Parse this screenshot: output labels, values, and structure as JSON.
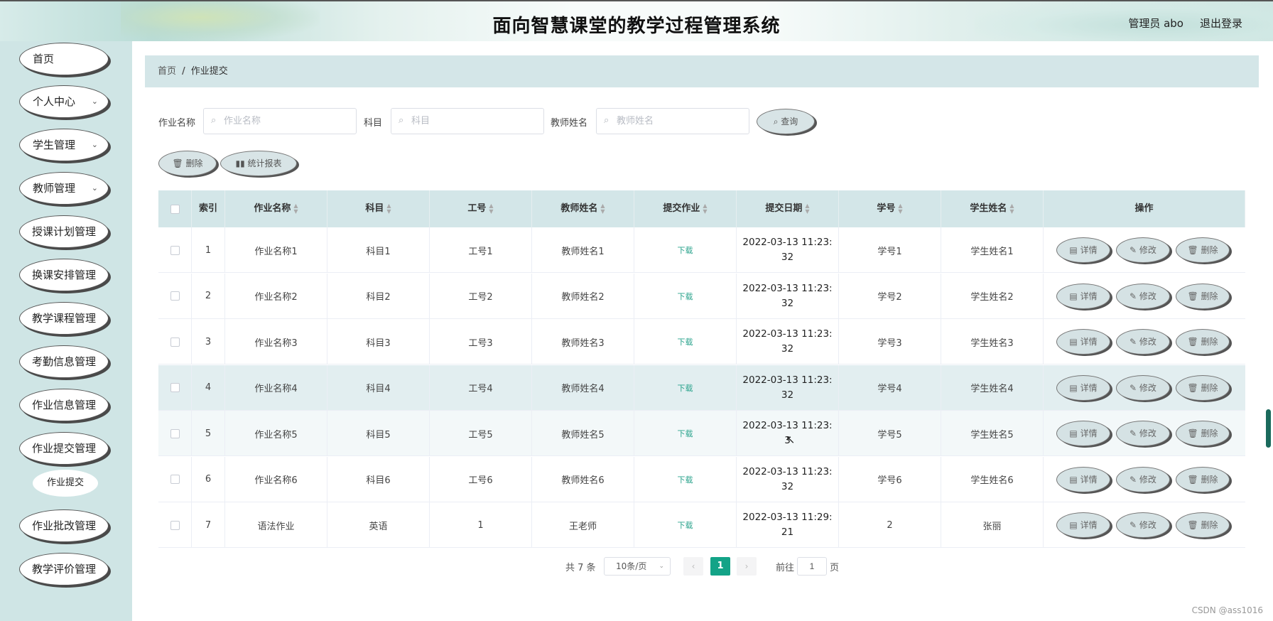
{
  "header": {
    "title": "面向智慧课堂的教学过程管理系统",
    "user": "管理员 abo",
    "logout": "退出登录"
  },
  "sidebar": {
    "items": [
      {
        "label": "首页",
        "chevron": ""
      },
      {
        "label": "个人中心",
        "chevron": "⌄"
      },
      {
        "label": "学生管理",
        "chevron": "⌄"
      },
      {
        "label": "教师管理",
        "chevron": "⌄"
      },
      {
        "label": "授课计划管理",
        "chevron": ""
      },
      {
        "label": "换课安排管理",
        "chevron": ""
      },
      {
        "label": "教学课程管理",
        "chevron": ""
      },
      {
        "label": "考勤信息管理",
        "chevron": ""
      },
      {
        "label": "作业信息管理",
        "chevron": ""
      },
      {
        "label": "作业提交管理",
        "chevron": ""
      },
      {
        "label": "作业批改管理",
        "chevron": ""
      },
      {
        "label": "教学评价管理",
        "chevron": ""
      }
    ],
    "submenu": {
      "label": "作业提交"
    }
  },
  "breadcrumb": {
    "home": "首页",
    "separator": "/",
    "current": "作业提交"
  },
  "search": {
    "homework_label": "作业名称",
    "homework_placeholder": "作业名称",
    "subject_label": "科目",
    "subject_placeholder": "科目",
    "teacher_label": "教师姓名",
    "teacher_placeholder": "教师姓名",
    "query_button": "查询",
    "search_icon": "search-icon"
  },
  "actions": {
    "delete_label": "删除",
    "report_label": "统计报表"
  },
  "table": {
    "columns": [
      "索引",
      "作业名称",
      "科目",
      "工号",
      "教师姓名",
      "提交作业",
      "提交日期",
      "学号",
      "学生姓名",
      "操作"
    ],
    "rows": [
      {
        "index": "1",
        "name": "作业名称1",
        "subject": "科目1",
        "job_no": "工号1",
        "teacher": "教师姓名1",
        "file": "下载",
        "date": "2022-03-13 11:23:32",
        "student_no": "学号1",
        "student": "学生姓名1"
      },
      {
        "index": "2",
        "name": "作业名称2",
        "subject": "科目2",
        "job_no": "工号2",
        "teacher": "教师姓名2",
        "file": "下载",
        "date": "2022-03-13 11:23:32",
        "student_no": "学号2",
        "student": "学生姓名2"
      },
      {
        "index": "3",
        "name": "作业名称3",
        "subject": "科目3",
        "job_no": "工号3",
        "teacher": "教师姓名3",
        "file": "下载",
        "date": "2022-03-13 11:23:32",
        "student_no": "学号3",
        "student": "学生姓名3"
      },
      {
        "index": "4",
        "name": "作业名称4",
        "subject": "科目4",
        "job_no": "工号4",
        "teacher": "教师姓名4",
        "file": "下载",
        "date": "2022-03-13 11:23:32",
        "student_no": "学号4",
        "student": "学生姓名4"
      },
      {
        "index": "5",
        "name": "作业名称5",
        "subject": "科目5",
        "job_no": "工号5",
        "teacher": "教师姓名5",
        "file": "下载",
        "date": "2022-03-13 11:23:3",
        "student_no": "学号5",
        "student": "学生姓名5"
      },
      {
        "index": "6",
        "name": "作业名称6",
        "subject": "科目6",
        "job_no": "工号6",
        "teacher": "教师姓名6",
        "file": "下载",
        "date": "2022-03-13 11:23:32",
        "student_no": "学号6",
        "student": "学生姓名6"
      },
      {
        "index": "7",
        "name": "语法作业",
        "subject": "英语",
        "job_no": "1",
        "teacher": "王老师",
        "file": "下载",
        "date": "2022-03-13 11:29:21",
        "student_no": "2",
        "student": "张丽"
      }
    ],
    "row_actions": {
      "detail": "详情",
      "edit": "修改",
      "delete": "删除"
    }
  },
  "pagination": {
    "total": "共 7 条",
    "page_size": "10条/页",
    "current_page": "1",
    "goto_prefix": "前往",
    "goto_value": "1",
    "goto_suffix": "页"
  },
  "watermark": "CSDN @ass1016",
  "colors": {
    "accent": "#13a387",
    "sidebar": "#cfe5e5",
    "table_header": "#d3e6e8",
    "download": "#2aa38c"
  }
}
